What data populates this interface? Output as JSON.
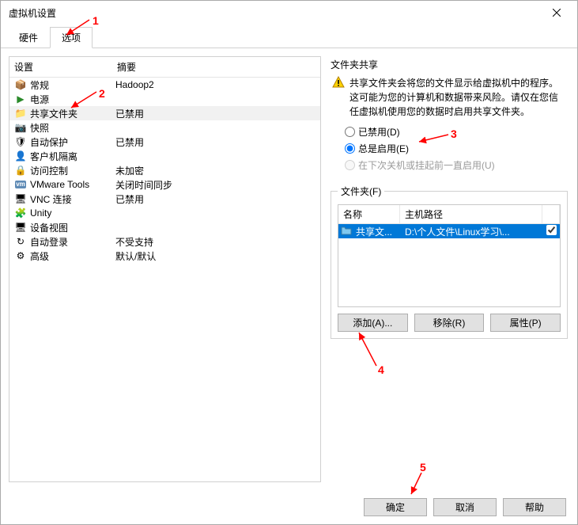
{
  "title": "虚拟机设置",
  "tabs": {
    "hardware": "硬件",
    "options": "选项"
  },
  "list_head": {
    "setting": "设置",
    "summary": "摘要"
  },
  "rows": [
    {
      "icon": "📦",
      "label": "常规",
      "summary": "Hadoop2"
    },
    {
      "icon": "▶",
      "label": "电源",
      "summary": ""
    },
    {
      "icon": "📁",
      "label": "共享文件夹",
      "summary": "已禁用",
      "sel": true
    },
    {
      "icon": "📷",
      "label": "快照",
      "summary": ""
    },
    {
      "icon": "🛡",
      "label": "自动保护",
      "summary": "已禁用"
    },
    {
      "icon": "👤",
      "label": "客户机隔离",
      "summary": ""
    },
    {
      "icon": "🔒",
      "label": "访问控制",
      "summary": "未加密"
    },
    {
      "icon": "vm",
      "label": "VMware Tools",
      "summary": "关闭时间同步"
    },
    {
      "icon": "🖥",
      "label": "VNC 连接",
      "summary": "已禁用"
    },
    {
      "icon": "🧩",
      "label": "Unity",
      "summary": ""
    },
    {
      "icon": "🖥",
      "label": "设备视图",
      "summary": ""
    },
    {
      "icon": "↻",
      "label": "自动登录",
      "summary": "不受支持"
    },
    {
      "icon": "⚙",
      "label": "高级",
      "summary": "默认/默认"
    }
  ],
  "share": {
    "title": "文件夹共享",
    "warning": "共享文件夹会将您的文件显示给虚拟机中的程序。这可能为您的计算机和数据带来风险。请仅在您信任虚拟机使用您的数据时启用共享文件夹。",
    "opt_disabled": "已禁用(D)",
    "opt_always": "总是启用(E)",
    "opt_until": "在下次关机或挂起前一直启用(U)"
  },
  "folders": {
    "legend": "文件夹(F)",
    "col_name": "名称",
    "col_path": "主机路径",
    "row_name": "共享文...",
    "row_path": "D:\\个人文件\\Linux学习\\...",
    "btn_add": "添加(A)...",
    "btn_remove": "移除(R)",
    "btn_props": "属性(P)"
  },
  "bottom": {
    "ok": "确定",
    "cancel": "取消",
    "help": "帮助"
  },
  "annotations": {
    "n1": "1",
    "n2": "2",
    "n3": "3",
    "n4": "4",
    "n5": "5"
  }
}
